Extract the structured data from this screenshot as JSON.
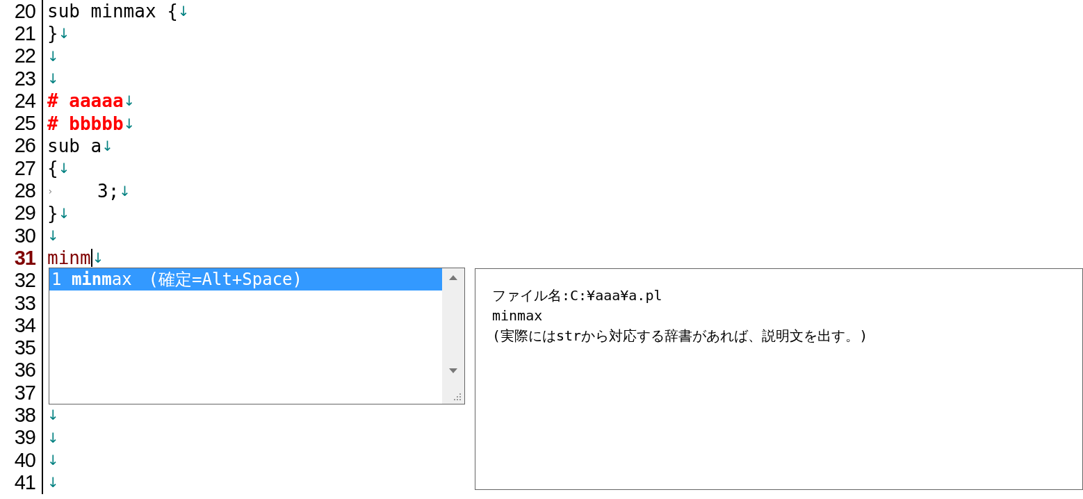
{
  "editor": {
    "lines": [
      {
        "number": "20",
        "current": false,
        "segments": [
          {
            "kind": "code",
            "text": "sub minmax {"
          }
        ],
        "eol": "↓"
      },
      {
        "number": "21",
        "current": false,
        "segments": [
          {
            "kind": "code",
            "text": "}"
          }
        ],
        "eol": "↓"
      },
      {
        "number": "22",
        "current": false,
        "eol": "↓"
      },
      {
        "number": "23",
        "current": false,
        "eol": "↓"
      },
      {
        "number": "24",
        "current": false,
        "segments": [
          {
            "kind": "comment",
            "text": "# aaaaa"
          }
        ],
        "eol": "↓"
      },
      {
        "number": "25",
        "current": false,
        "segments": [
          {
            "kind": "comment",
            "text": "# bbbbb"
          }
        ],
        "eol": "↓"
      },
      {
        "number": "26",
        "current": false,
        "segments": [
          {
            "kind": "code",
            "text": "sub a"
          }
        ],
        "eol": "↓"
      },
      {
        "number": "27",
        "current": false,
        "segments": [
          {
            "kind": "code",
            "text": "{"
          }
        ],
        "eol": "↓"
      },
      {
        "number": "28",
        "current": false,
        "segments": [
          {
            "kind": "tab",
            "text": "›"
          },
          {
            "kind": "code",
            "text": "3;"
          }
        ],
        "eol": "↓"
      },
      {
        "number": "29",
        "current": false,
        "segments": [
          {
            "kind": "code",
            "text": "}"
          }
        ],
        "eol": "↓"
      },
      {
        "number": "30",
        "current": false,
        "eol": "↓"
      },
      {
        "number": "31",
        "current": true,
        "segments": [
          {
            "kind": "code",
            "text": "minm"
          }
        ],
        "eol": "↓"
      },
      {
        "number": "32",
        "current": false
      },
      {
        "number": "33",
        "current": false
      },
      {
        "number": "34",
        "current": false
      },
      {
        "number": "35",
        "current": false
      },
      {
        "number": "36",
        "current": false
      },
      {
        "number": "37",
        "current": false
      },
      {
        "number": "38",
        "current": false,
        "eol": "↓"
      },
      {
        "number": "39",
        "current": false,
        "eol": "↓"
      },
      {
        "number": "40",
        "current": false,
        "eol": "↓"
      },
      {
        "number": "41",
        "current": false,
        "eol": "↓"
      }
    ]
  },
  "completion": {
    "items": [
      {
        "text": "1 **minm**ax　(確定=Alt+Space)",
        "selected": true
      }
    ]
  },
  "description": {
    "lines": [
      "ファイル名:C:¥aaa¥a.pl",
      "minmax",
      "(実際にはstrから対応する辞書があれば、説明文を出す。)"
    ]
  }
}
